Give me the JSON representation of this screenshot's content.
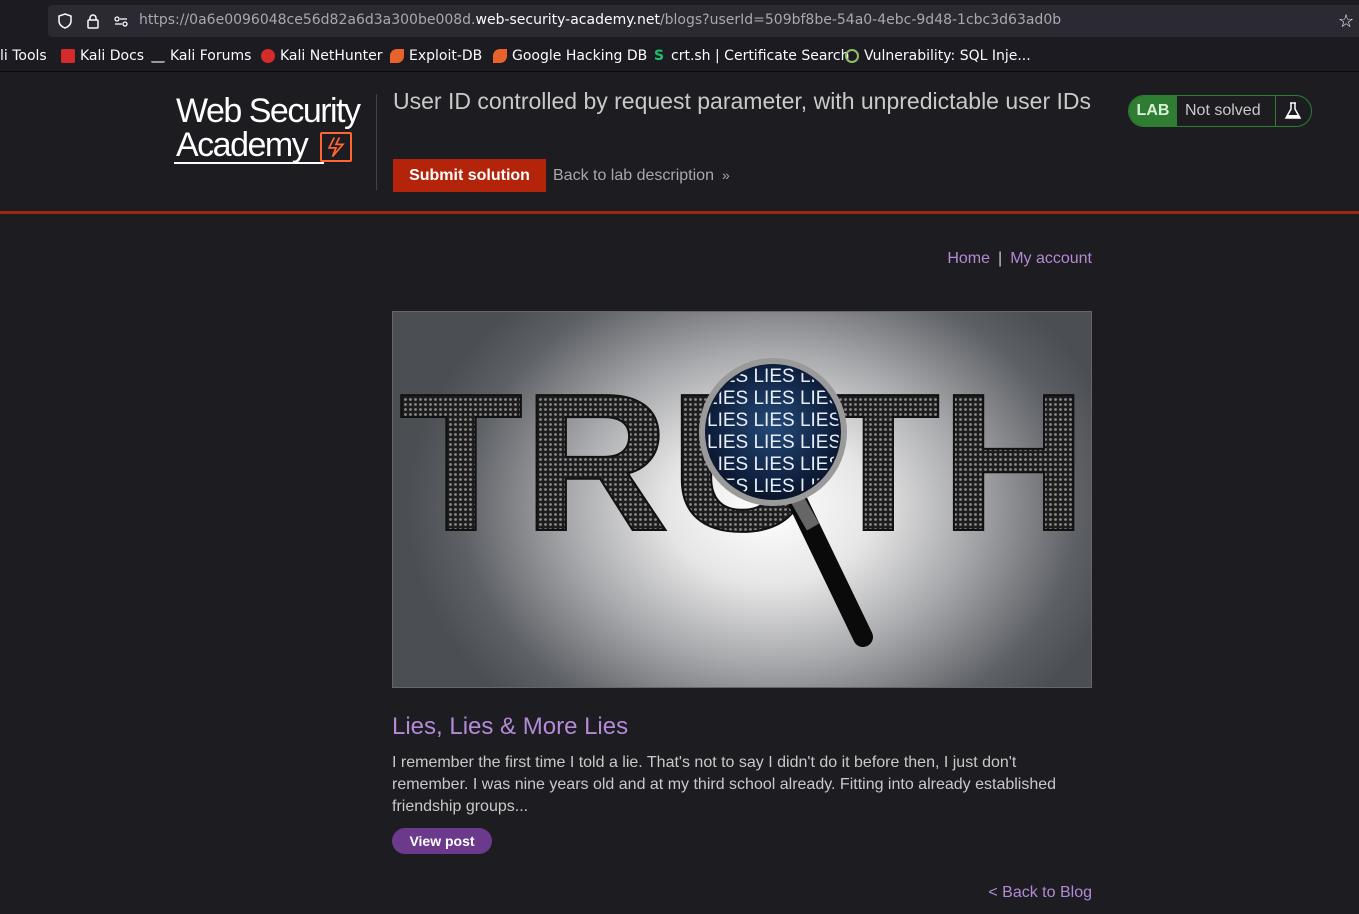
{
  "browser": {
    "url_prefix": "https://0a6e0096048ce56d82a6d3a300be008d.",
    "url_host": "web-security-academy.net",
    "url_path": "/blogs?userId=509bf8be-54a0-4ebc-9d48-1cbc3d63ad0b",
    "bookmarks": [
      {
        "label": "li Tools",
        "icon": "none",
        "color": ""
      },
      {
        "label": "Kali Docs",
        "icon": "kali-docs-icon",
        "color": "#d62b2b"
      },
      {
        "label": "Kali Forums",
        "icon": "kali-dragon-icon",
        "color": "#999999"
      },
      {
        "label": "Kali NetHunter",
        "icon": "nethunter-icon",
        "color": "#d62b2b"
      },
      {
        "label": "Exploit-DB",
        "icon": "exploit-db-icon",
        "color": "#e8632b"
      },
      {
        "label": "Google Hacking DB",
        "icon": "ghdb-icon",
        "color": "#e8632b"
      },
      {
        "label": "crt.sh | Certificate Search",
        "icon": "crtsh-icon",
        "color": "#1fbf6a"
      },
      {
        "label": "Vulnerability: SQL Inje...",
        "icon": "dvwa-icon",
        "color": "#8fbf6a"
      }
    ]
  },
  "lab": {
    "logo_line1": "Web Security",
    "logo_line2": "Academy",
    "title": "User ID controlled by request parameter, with unpredictable user IDs",
    "submit_label": "Submit solution",
    "back_label": "Back to lab description",
    "status_tag": "LAB",
    "status_text": "Not solved",
    "colors": {
      "accent": "#b4240a",
      "status_green": "#2e7d32",
      "link": "#b38ad6"
    }
  },
  "nav": {
    "home": "Home",
    "account": "My account"
  },
  "post": {
    "image_words": {
      "truth": "TRUTH",
      "lies": "LIES LIES LIES LIES"
    },
    "title": "Lies, Lies & More Lies",
    "summary": "I remember the first time I told a lie. That's not to say I didn't do it before then, I just don't remember. I was nine years old and at my third school already. Fitting into already established friendship groups...",
    "view_label": "View post",
    "back_label": "< Back to Blog"
  }
}
